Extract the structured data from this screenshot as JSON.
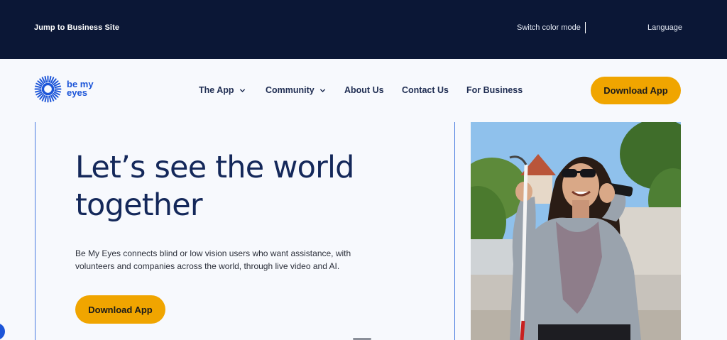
{
  "topbar": {
    "jump_label": "Jump to Business Site",
    "switch_color_label": "Switch color mode",
    "language_label": "Language"
  },
  "brand": {
    "logo_line1": "be my",
    "logo_line2": "eyes",
    "logo_color": "#1c55d8"
  },
  "nav": {
    "items": [
      {
        "label": "The App",
        "has_dropdown": true
      },
      {
        "label": "Community",
        "has_dropdown": true
      },
      {
        "label": "About Us",
        "has_dropdown": false
      },
      {
        "label": "Contact Us",
        "has_dropdown": false
      },
      {
        "label": "For Business",
        "has_dropdown": false
      }
    ],
    "download_label": "Download App"
  },
  "hero": {
    "title": "Let’s see the world together",
    "subtitle": "Be My Eyes connects blind or low vision users who want assistance, with volunteers and companies across the world, through live video and AI.",
    "download_label": "Download App"
  },
  "colors": {
    "topbar_bg": "#0b1736",
    "accent_button": "#f0a500",
    "heading": "#14285a",
    "page_bg": "#f7f9fd"
  },
  "icons": {
    "logo": "sunburst-eye-icon",
    "dropdown": "chevron-down-icon",
    "accessibility": "accessibility-widget-icon"
  }
}
